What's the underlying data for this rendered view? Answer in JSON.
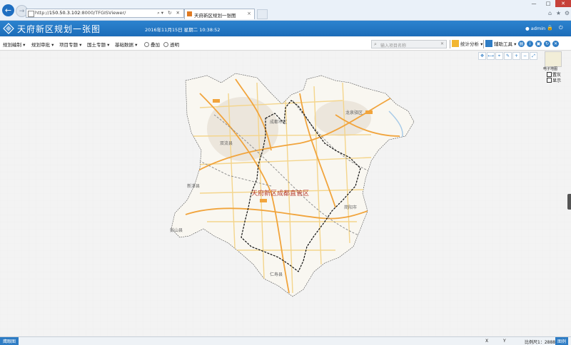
{
  "browser": {
    "url_prefix": "http://",
    "url_host": "150.50.3.102",
    "url_rest": ":8000/TFGISViewer/",
    "tab_title": "天府新区规划一张图",
    "win_min": "—",
    "win_max": "□",
    "win_close": "✕"
  },
  "header": {
    "title": "天府新区规划一张图",
    "date": "2016年11月15日  星期二  10:38:52",
    "user": "admin"
  },
  "menu": {
    "items": [
      "规划编制",
      "规划审批",
      "项目专题",
      "国土专题",
      "基础数据"
    ],
    "radios": [
      "叠加",
      "透明"
    ]
  },
  "search": {
    "placeholder": "输入项目名称"
  },
  "tools": {
    "stats_label": "统计分析",
    "aux_label": "辅助工具"
  },
  "map_panel": {
    "map_type_label": "电子地图",
    "gray_label": "置灰",
    "show_label": "显示"
  },
  "map_labels": {
    "main": "天府新区成都直管区",
    "places": [
      "新津县",
      "彭山县",
      "双流县",
      "仁寿县",
      "简阳市",
      "龙泉驿区",
      "成都市区"
    ]
  },
  "status": {
    "left": "鹰眼图",
    "x_label": "X",
    "y_label": "Y",
    "scale": "比例尺1：288895",
    "right": "图例"
  },
  "colors": {
    "header_blue": "#1c6cb8",
    "road_orange": "#f1a43c",
    "road_yellow": "#f4d58c",
    "boundary": "#222222",
    "water": "#a8cbe8"
  }
}
